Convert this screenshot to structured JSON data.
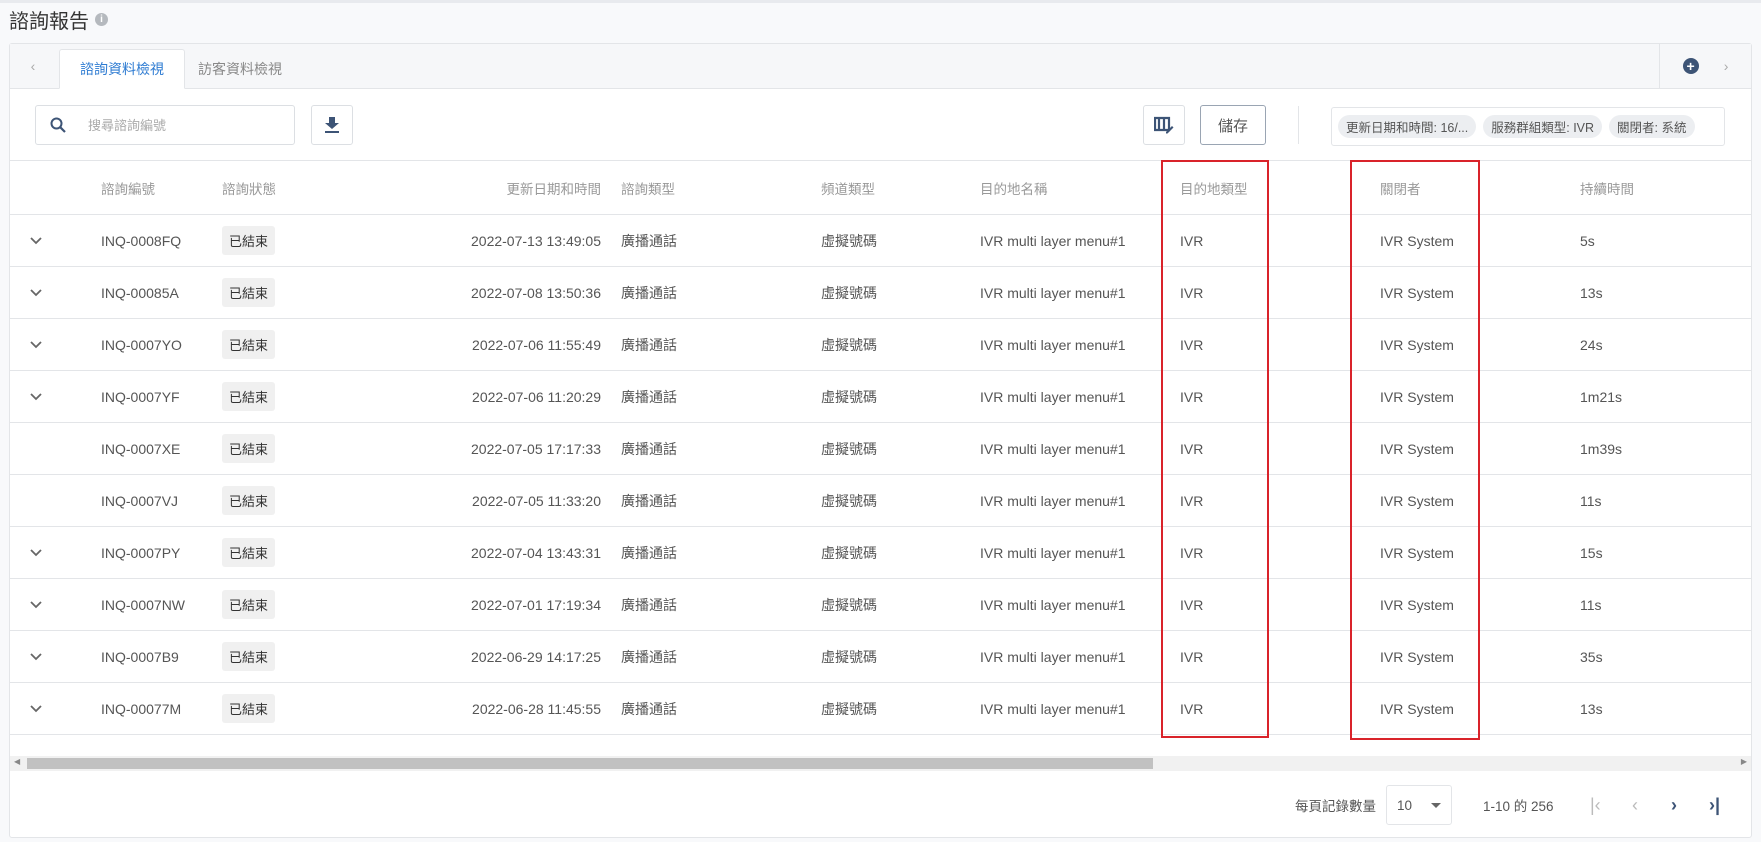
{
  "page": {
    "title": "諮詢報告"
  },
  "tabs": [
    {
      "label": "諮詢資料檢視",
      "active": true
    },
    {
      "label": "訪客資料檢視",
      "active": false
    }
  ],
  "toolbar": {
    "search_placeholder": "搜尋諮詢編號",
    "save_label": "儲存",
    "filters": [
      "更新日期和時間: 16/...",
      "服務群組類型: IVR",
      "關閉者: 系統"
    ]
  },
  "columns": [
    "諮詢編號",
    "諮詢狀態",
    "更新日期和時間",
    "諮詢類型",
    "頻道類型",
    "目的地名稱",
    "目的地類型",
    "關閉者",
    "持續時間"
  ],
  "rows": [
    {
      "expand": true,
      "id": "INQ-0008FQ",
      "status": "已結束",
      "updated": "2022-07-13 13:49:05",
      "type": "廣播通話",
      "channel": "虛擬號碼",
      "dest_name": "IVR multi layer menu#1",
      "dest_type": "IVR",
      "closed_by": "IVR System",
      "duration": "5s"
    },
    {
      "expand": true,
      "id": "INQ-00085A",
      "status": "已結束",
      "updated": "2022-07-08 13:50:36",
      "type": "廣播通話",
      "channel": "虛擬號碼",
      "dest_name": "IVR multi layer menu#1",
      "dest_type": "IVR",
      "closed_by": "IVR System",
      "duration": "13s"
    },
    {
      "expand": true,
      "id": "INQ-0007YO",
      "status": "已結束",
      "updated": "2022-07-06 11:55:49",
      "type": "廣播通話",
      "channel": "虛擬號碼",
      "dest_name": "IVR multi layer menu#1",
      "dest_type": "IVR",
      "closed_by": "IVR System",
      "duration": "24s"
    },
    {
      "expand": true,
      "id": "INQ-0007YF",
      "status": "已結束",
      "updated": "2022-07-06 11:20:29",
      "type": "廣播通話",
      "channel": "虛擬號碼",
      "dest_name": "IVR multi layer menu#1",
      "dest_type": "IVR",
      "closed_by": "IVR System",
      "duration": "1m21s"
    },
    {
      "expand": false,
      "id": "INQ-0007XE",
      "status": "已結束",
      "updated": "2022-07-05 17:17:33",
      "type": "廣播通話",
      "channel": "虛擬號碼",
      "dest_name": "IVR multi layer menu#1",
      "dest_type": "IVR",
      "closed_by": "IVR System",
      "duration": "1m39s"
    },
    {
      "expand": false,
      "id": "INQ-0007VJ",
      "status": "已結束",
      "updated": "2022-07-05 11:33:20",
      "type": "廣播通話",
      "channel": "虛擬號碼",
      "dest_name": "IVR multi layer menu#1",
      "dest_type": "IVR",
      "closed_by": "IVR System",
      "duration": "11s"
    },
    {
      "expand": true,
      "id": "INQ-0007PY",
      "status": "已結束",
      "updated": "2022-07-04 13:43:31",
      "type": "廣播通話",
      "channel": "虛擬號碼",
      "dest_name": "IVR multi layer menu#1",
      "dest_type": "IVR",
      "closed_by": "IVR System",
      "duration": "15s"
    },
    {
      "expand": true,
      "id": "INQ-0007NW",
      "status": "已結束",
      "updated": "2022-07-01 17:19:34",
      "type": "廣播通話",
      "channel": "虛擬號碼",
      "dest_name": "IVR multi layer menu#1",
      "dest_type": "IVR",
      "closed_by": "IVR System",
      "duration": "11s"
    },
    {
      "expand": true,
      "id": "INQ-0007B9",
      "status": "已結束",
      "updated": "2022-06-29 14:17:25",
      "type": "廣播通話",
      "channel": "虛擬號碼",
      "dest_name": "IVR multi layer menu#1",
      "dest_type": "IVR",
      "closed_by": "IVR System",
      "duration": "35s"
    },
    {
      "expand": true,
      "id": "INQ-00077M",
      "status": "已結束",
      "updated": "2022-06-28 11:45:55",
      "type": "廣播通話",
      "channel": "虛擬號碼",
      "dest_name": "IVR multi layer menu#1",
      "dest_type": "IVR",
      "closed_by": "IVR System",
      "duration": "13s"
    }
  ],
  "pagination": {
    "rows_per_page_label": "每頁記錄數量",
    "rows_per_page": "10",
    "range": "1-10 的 256"
  },
  "colors": {
    "accent": "#2d7bd2",
    "highlight": "#d9232a",
    "icon": "#3d5476"
  }
}
